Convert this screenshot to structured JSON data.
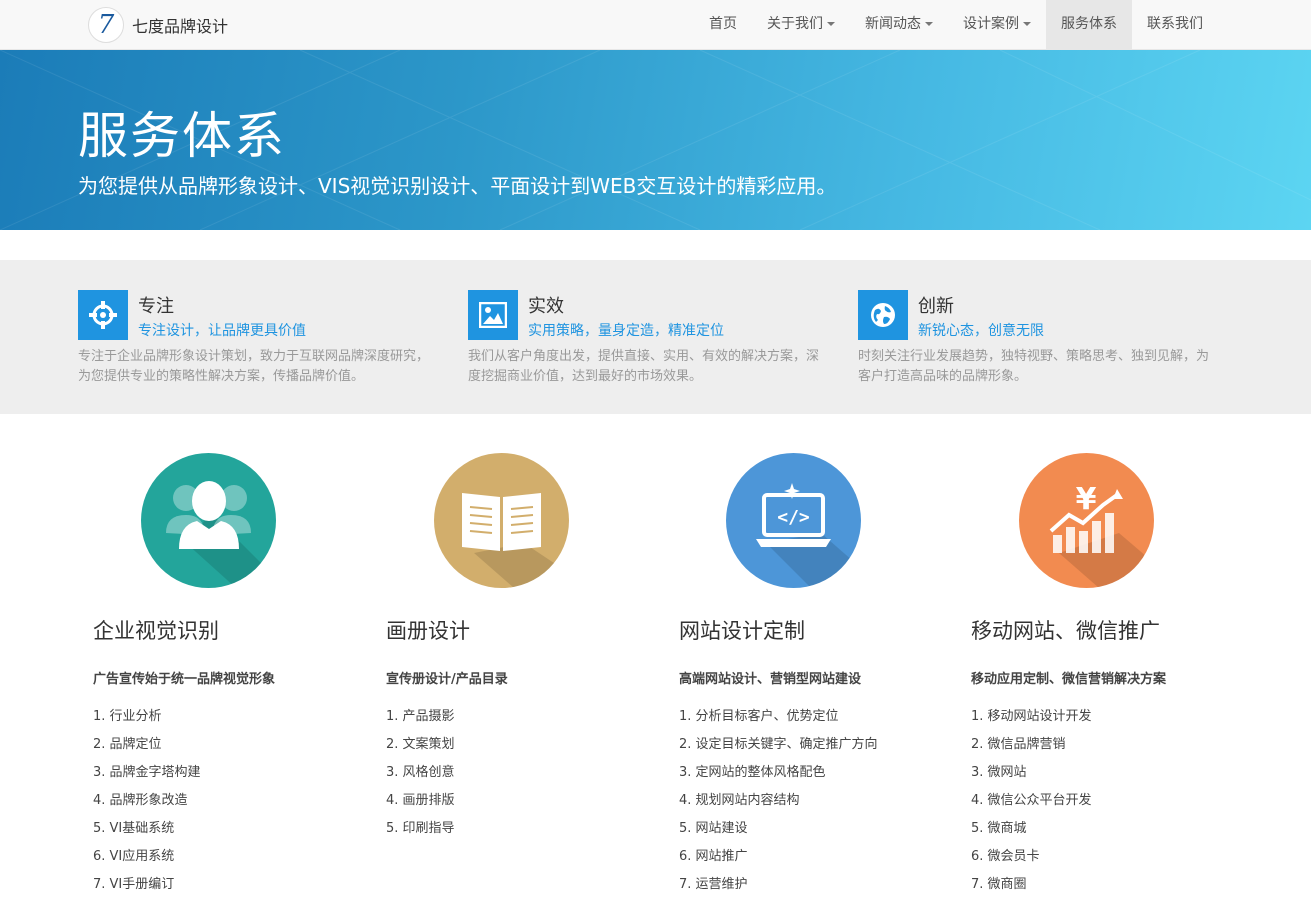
{
  "navbar": {
    "logo_glyph": "7",
    "brand": "七度品牌设计",
    "items": [
      {
        "label": "首页",
        "dropdown": false
      },
      {
        "label": "关于我们",
        "dropdown": true
      },
      {
        "label": "新闻动态",
        "dropdown": true
      },
      {
        "label": "设计案例",
        "dropdown": true
      },
      {
        "label": "服务体系",
        "dropdown": false,
        "active": true
      },
      {
        "label": "联系我们",
        "dropdown": false
      }
    ]
  },
  "hero": {
    "title": "服务体系",
    "subtitle": "为您提供从品牌形象设计、VIS视觉识别设计、平面设计到WEB交互设计的精彩应用。"
  },
  "features": [
    {
      "icon": "crosshair-icon",
      "title": "专注",
      "subtitle": "专注设计，让品牌更具价值",
      "description": "专注于企业品牌形象设计策划，致力于互联网品牌深度研究，为您提供专业的策略性解决方案，传播品牌价值。"
    },
    {
      "icon": "picture-icon",
      "title": "实效",
      "subtitle": "实用策略，量身定造，精准定位",
      "description": "我们从客户角度出发，提供直接、实用、有效的解决方案，深度挖掘商业价值，达到最好的市场效果。"
    },
    {
      "icon": "globe-icon",
      "title": "创新",
      "subtitle": "新锐心态，创意无限",
      "description": "时刻关注行业发展趋势，独特视野、策略思考、独到见解，为客户打造高品味的品牌形象。"
    }
  ],
  "services": [
    {
      "icon": "users-icon",
      "color": "#23a59b",
      "title": "企业视觉识别",
      "subtitle": "广告宣传始于统一品牌视觉形象",
      "items": [
        "1. 行业分析",
        "2. 品牌定位",
        "3. 品牌金字塔构建",
        "4. 品牌形象改造",
        "5. VI基础系统",
        "6. VI应用系统",
        "7. VI手册编订"
      ]
    },
    {
      "icon": "book-icon",
      "color": "#d2ae6c",
      "title": "画册设计",
      "subtitle": "宣传册设计/产品目录",
      "items": [
        "1. 产品摄影",
        "2. 文案策划",
        "3. 风格创意",
        "4. 画册排版",
        "5. 印刷指导"
      ]
    },
    {
      "icon": "laptop-code-icon",
      "color": "#4d96d8",
      "title": "网站设计定制",
      "subtitle": "高端网站设计、营销型网站建设",
      "items": [
        "1. 分析目标客户、优势定位",
        "2. 设定目标关键字、确定推广方向",
        "3. 定网站的整体风格配色",
        "4. 规划网站内容结构",
        "5. 网站建设",
        "6. 网站推广",
        "7. 运营维护"
      ]
    },
    {
      "icon": "yen-chart-icon",
      "color": "#f28b50",
      "title": "移动网站、微信推广",
      "subtitle": "移动应用定制、微信营销解决方案",
      "items": [
        "1. 移动网站设计开发",
        "2. 微信品牌营销",
        "3. 微网站",
        "4. 微信公众平台开发",
        "5. 微商城",
        "6. 微会员卡",
        "7. 微商圈"
      ]
    }
  ]
}
